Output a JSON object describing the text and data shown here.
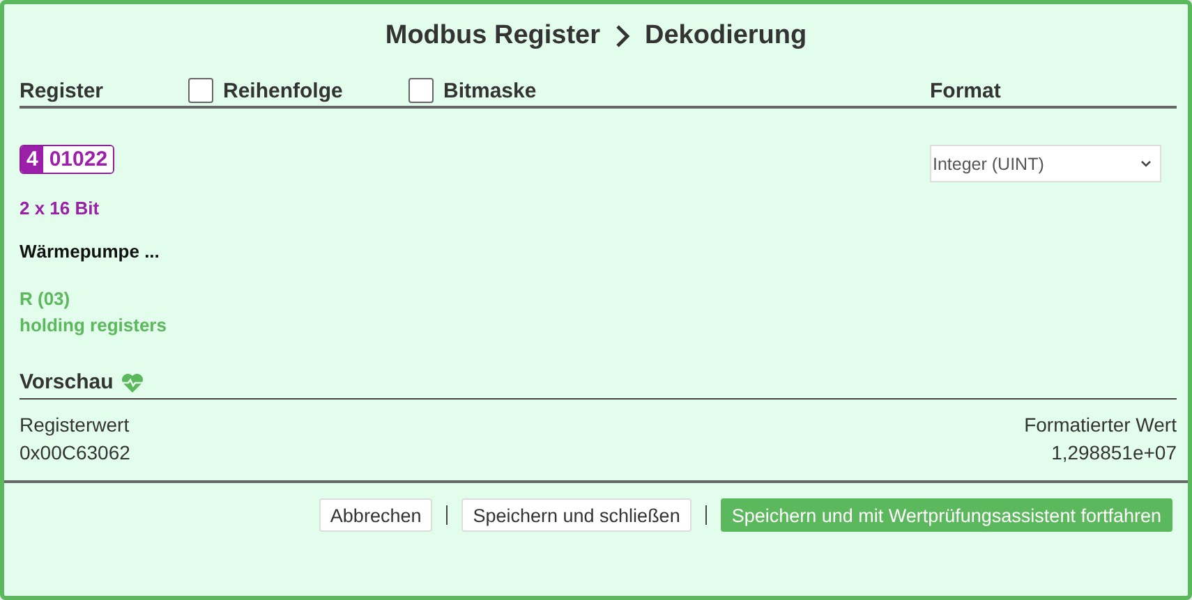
{
  "title": {
    "parts": [
      "Modbus Register",
      "Dekodierung"
    ]
  },
  "columns": [
    {
      "kind": "label",
      "label": "Register"
    },
    {
      "kind": "checkbox",
      "label": "Reihenfolge",
      "checked": false
    },
    {
      "kind": "checkbox",
      "label": "Bitmaske",
      "checked": false
    },
    {
      "kind": "label",
      "label": "Format"
    }
  ],
  "register": {
    "prefix": "4",
    "address": "01022",
    "size": "2 x 16 Bit",
    "name": "Wärmepumpe ...",
    "access": "R (03)",
    "type": "holding registers"
  },
  "format": {
    "value": "Integer (UINT)"
  },
  "preview": {
    "title": "Vorschau",
    "register_label": "Registerwert",
    "register_value": "0x00C63062",
    "formatted_label": "Formatierter Wert",
    "formatted_value": "1,298851e+07"
  },
  "buttons": [
    {
      "label": "Abbrechen",
      "kind": "default"
    },
    {
      "label": "Speichern und schließen",
      "kind": "default"
    },
    {
      "label": "Speichern und mit Wertprüfungsassistent fortfahren",
      "kind": "primary"
    }
  ]
}
